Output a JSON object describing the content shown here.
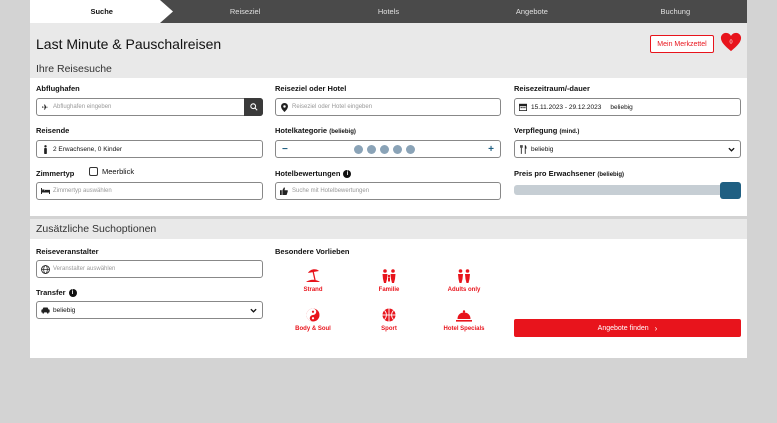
{
  "steps": [
    "Suche",
    "Reiseziel",
    "Hotels",
    "Angebote",
    "Buchung"
  ],
  "page_title": "Last Minute & Pauschalreisen",
  "merkzettel_label": "Mein Merkzettel",
  "merkzettel_count": "0",
  "section_search": "Ihre Reisesuche",
  "abflughafen": {
    "label": "Abflughafen",
    "placeholder": "Abflughafen eingeben"
  },
  "reiseziel": {
    "label": "Reiseziel oder Hotel",
    "placeholder": "Reiseziel oder Hotel eingeben"
  },
  "zeitraum": {
    "label": "Reisezeitraum/-dauer",
    "dates": "15.11.2023 - 29.12.2023",
    "duration": "beliebig"
  },
  "reisende": {
    "label": "Reisende",
    "value": "2 Erwachsene, 0 Kinder"
  },
  "hotelkategorie": {
    "label": "Hotelkategorie",
    "qualifier": "(beliebig)",
    "minus": "−",
    "plus": "+"
  },
  "verpflegung": {
    "label": "Verpflegung",
    "qualifier": "(mind.)",
    "value": "beliebig"
  },
  "zimmertyp": {
    "label": "Zimmertyp",
    "checkbox_label": "Meerblick",
    "placeholder": "Zimmertyp auswählen"
  },
  "bewertungen": {
    "label": "Hotelbewertungen",
    "placeholder": "Suche mit Hotelbewertungen"
  },
  "preis": {
    "label": "Preis pro Erwachsener",
    "qualifier": "(beliebig)",
    "level": 1.0
  },
  "section_options": "Zusätzliche Suchoptionen",
  "veranstalter": {
    "label": "Reiseveranstalter",
    "placeholder": "Veranstalter auswählen"
  },
  "transfer": {
    "label": "Transfer",
    "value": "beliebig"
  },
  "vorlieben": {
    "label": "Besondere Vorlieben",
    "items": [
      "Strand",
      "Familie",
      "Adults only",
      "Body & Soul",
      "Sport",
      "Hotel Specials"
    ]
  },
  "submit_label": "Angebote finden",
  "colors": {
    "accent": "#e8141c",
    "nav": "#4a4a4a",
    "slider": "#1f5f82"
  }
}
